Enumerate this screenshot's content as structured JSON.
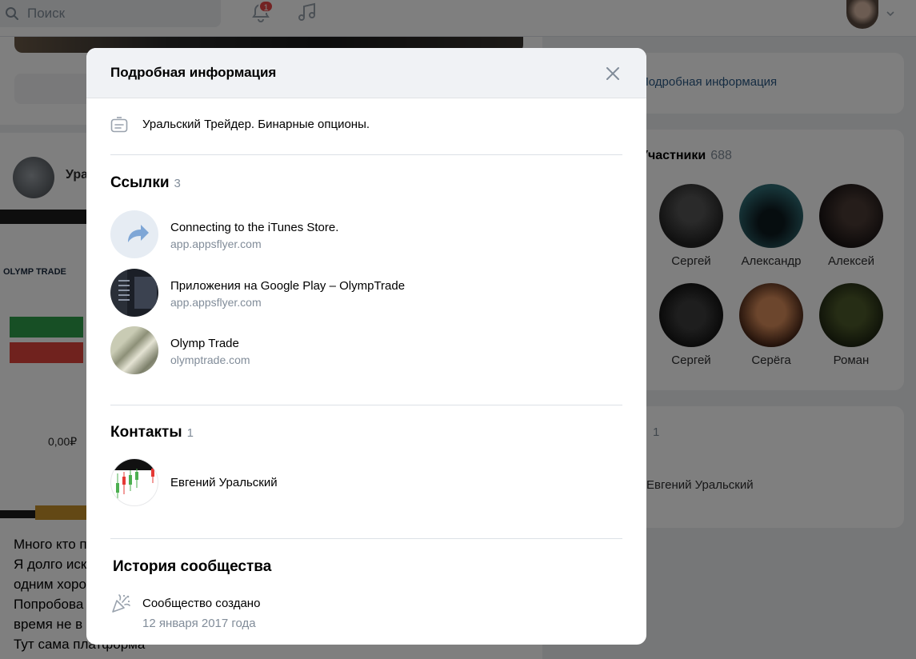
{
  "background": {
    "search": {
      "placeholder": "Поиск"
    },
    "notifications": {
      "badge": "1"
    },
    "right_panel": {
      "info_link": "Подробная информация",
      "members_header": "Участники",
      "members_count": "688",
      "members": [
        {
          "name": "Сергей"
        },
        {
          "name": "Александр"
        },
        {
          "name": "Алексей"
        },
        {
          "name": "Сергей"
        },
        {
          "name": "Серёга"
        },
        {
          "name": "Роман"
        }
      ],
      "contacts_count": "1",
      "contact_name": "Евгений Уральский"
    },
    "post": {
      "author": "Уральский Трейдер",
      "screenshot_title": "OLYMP TRADE",
      "amount": "0,00₽",
      "text": "Много кто п\nЯ долго иск\nодним хоро\nПопробова\nвремя не в\nТут сама платформа"
    }
  },
  "modal": {
    "title": "Подробная информация",
    "description": "Уральский Трейдер. Бинарные опционы.",
    "links": {
      "title": "Ссылки",
      "count": "3",
      "items": [
        {
          "title": "Connecting to the iTunes Store.",
          "domain": "app.appsflyer.com"
        },
        {
          "title": "Приложения на Google Play – OlympTrade",
          "domain": "app.appsflyer.com"
        },
        {
          "title": "Olymp Trade",
          "domain": "olymptrade.com"
        }
      ]
    },
    "contacts": {
      "title": "Контакты",
      "count": "1",
      "items": [
        {
          "name": "Евгений Уральский"
        }
      ]
    },
    "history": {
      "title": "История сообщества",
      "created_label": "Сообщество создано",
      "created_date": "12 января 2017 года"
    }
  },
  "colors": {
    "accent": "#2a5885",
    "secondary_text": "#818c99",
    "icon": "#99a2ad"
  }
}
